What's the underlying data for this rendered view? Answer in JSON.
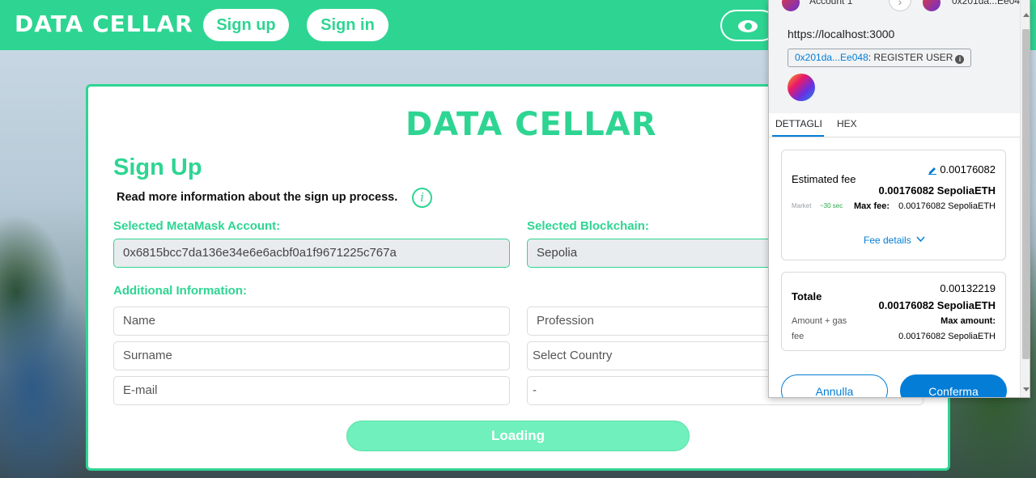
{
  "header": {
    "logo": "DATA CELLAR",
    "signup_label": "Sign up",
    "signin_label": "Sign in"
  },
  "signup": {
    "logo": "DATA CELLAR",
    "title": "Sign Up",
    "info_text": "Read more information about the sign up process.",
    "metamask_label": "Selected MetaMask Account:",
    "metamask_value": "0x6815bcc7da136e34e6e6acbf0a1f9671225c767a",
    "blockchain_label": "Selected Blockchain:",
    "blockchain_value": "Sepolia",
    "additional_label": "Additional Information:",
    "fields": {
      "name": "Name",
      "surname": "Surname",
      "email": "E-mail",
      "profession": "Profession",
      "country": "Select Country",
      "region": "-"
    },
    "loading_label": "Loading"
  },
  "metamask": {
    "account_label": "Account 1",
    "to_label": "0x201da...Ee048",
    "origin": "https://localhost:3000",
    "contract_address": "0x201da...Ee048",
    "method": ": REGISTER USER",
    "tabs": [
      "DETTAGLI",
      "HEX"
    ],
    "estimated_fee_label": "Estimated fee",
    "estimated_fee_value": "0.00176082",
    "estimated_fee_eth": "0.00176082 SepoliaETH",
    "market_label": "Market",
    "market_time": "~30 sec",
    "max_fee_label": "Max fee:",
    "max_fee_value": "0.00176082 SepoliaETH",
    "fee_details_label": "Fee details",
    "total_label": "Totale",
    "total_value": "0.00132219",
    "total_eth": "0.00176082 SepoliaETH",
    "amount_gas_label_1": "Amount + gas",
    "amount_gas_label_2": "fee",
    "max_amount_label": "Max amount:",
    "max_amount_value": "0.00176082 SepoliaETH",
    "cancel_label": "Annulla",
    "confirm_label": "Conferma"
  },
  "colors": {
    "brand_green": "#2ed592",
    "metamask_blue": "#037dd6"
  },
  "icons": [
    "eye-icon",
    "info-icon",
    "edit-icon",
    "chevron-down-icon",
    "arrow-right-icon"
  ]
}
